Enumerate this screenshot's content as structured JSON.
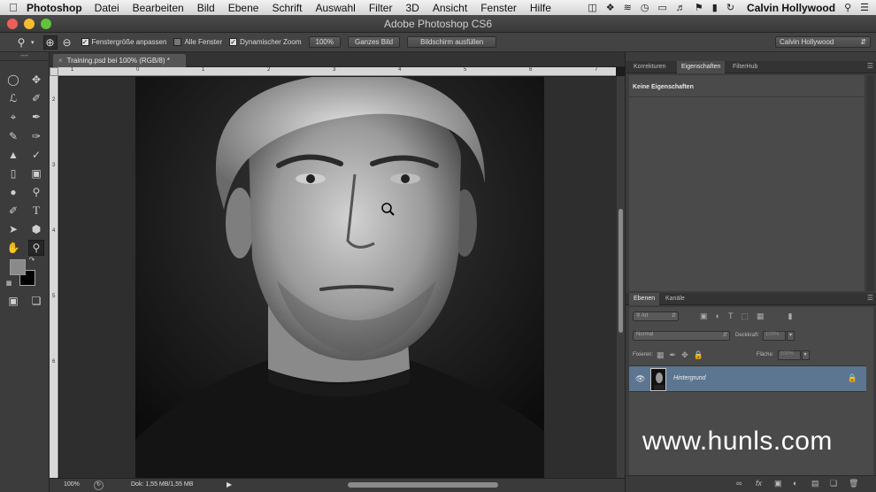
{
  "menubar": {
    "app_name": "Photoshop",
    "items": [
      "Datei",
      "Bearbeiten",
      "Bild",
      "Ebene",
      "Schrift",
      "Auswahl",
      "Filter",
      "3D",
      "Ansicht",
      "Fenster",
      "Hilfe"
    ],
    "user": "Calvin Hollywood"
  },
  "window": {
    "title": "Adobe Photoshop CS6"
  },
  "options_bar": {
    "fenstergroesse_label": "Fenstergröße anpassen",
    "alle_fenster_label": "Alle Fenster",
    "dynamischer_zoom_label": "Dynamischer Zoom",
    "zoom_100_label": "100%",
    "ganzes_bild_label": "Ganzes Bild",
    "bildschirm_fuellen_label": "Bildschirm ausfüllen",
    "workspace": "Calvin Hollywood"
  },
  "document": {
    "tab_label": "Training.psd bei 100% (RGB/8) *",
    "ruler_h": [
      "1",
      "0",
      "1",
      "2",
      "3",
      "4",
      "5",
      "6",
      "7"
    ],
    "ruler_v": [
      "2",
      "3",
      "4",
      "5",
      "6"
    ]
  },
  "status": {
    "zoom": "100%",
    "doc_size": "Dok: 1,55 MB/1,55 MB"
  },
  "properties_panel": {
    "tabs": [
      "Korrekturen",
      "Eigenschaften",
      "FilterHub"
    ],
    "active_tab": "Eigenschaften",
    "heading": "Keine Eigenschaften"
  },
  "layers_panel": {
    "tabs": [
      "Ebenen",
      "Kanäle"
    ],
    "filter_label": "Art",
    "blend_mode": "Normal",
    "opacity_label": "Deckkraft:",
    "fixieren_label": "Fixieren:",
    "flaeche_label": "Fläche:",
    "layer_name": "Hintergrund"
  },
  "watermark": "www.hunls.com",
  "colors": {
    "layer_selected": "#5c7691",
    "traffic_red": "#ec5f57",
    "traffic_yellow": "#f5bd2f",
    "traffic_green": "#5fc43a"
  }
}
